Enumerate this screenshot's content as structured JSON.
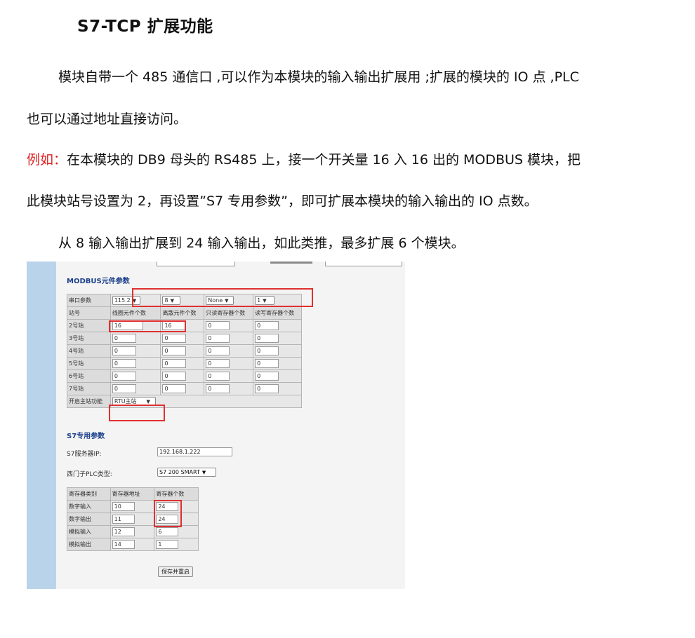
{
  "title": "S7-TCP 扩展功能",
  "paragraphs": {
    "p1_line1": "模块自带一个 485 通信口 ,可以作为本模块的输入输出扩展用 ;扩展的模块的 IO 点 ,PLC",
    "p1_line2": "也可以通过地址直接访问。",
    "example_label": "例如：",
    "p2_line1": "在本模块的 DB9 母头的 RS485 上，接一个开关量 16 入 16 出的 MODBUS 模块，把",
    "p2_line2": "此模块站号设置为 2，再设置”S7 专用参数”，即可扩展本模块的输入输出的 IO 点数。",
    "p3": "从 8 输入输出扩展到 24 输入输出，如此类推，最多扩展 6 个模块。"
  },
  "screenshot": {
    "modbus_title": "MODBUS元件参数",
    "serial_label": "串口参数",
    "serial_baud": "115.2",
    "serial_bits": "8",
    "serial_parity": "None",
    "serial_stop": "1",
    "headers": [
      "站号",
      "线圈元件个数",
      "离散元件个数",
      "只读寄存器个数",
      "读写寄存器个数"
    ],
    "stations": [
      {
        "name": "2号站",
        "v": [
          "16",
          "16",
          "0",
          "0"
        ]
      },
      {
        "name": "3号站",
        "v": [
          "0",
          "0",
          "0",
          "0"
        ]
      },
      {
        "name": "4号站",
        "v": [
          "0",
          "0",
          "0",
          "0"
        ]
      },
      {
        "name": "5号站",
        "v": [
          "0",
          "0",
          "0",
          "0"
        ]
      },
      {
        "name": "6号站",
        "v": [
          "0",
          "0",
          "0",
          "0"
        ]
      },
      {
        "name": "7号站",
        "v": [
          "0",
          "0",
          "0",
          "0"
        ]
      }
    ],
    "master_label": "开启主站功能",
    "master_value": "RTU主站",
    "s7_title": "S7专用参数",
    "server_ip_label": "S7服务器IP:",
    "server_ip_value": "192.168.1.222",
    "plc_type_label": "西门子PLC类型:",
    "plc_type_value": "S7 200 SMART",
    "reg_headers": [
      "寄存器类别",
      "寄存器地址",
      "寄存器个数"
    ],
    "reg_rows": [
      {
        "type": "数字输入",
        "addr": "10",
        "count": "24"
      },
      {
        "type": "数字输出",
        "addr": "11",
        "count": "24"
      },
      {
        "type": "模拟输入",
        "addr": "12",
        "count": "6"
      },
      {
        "type": "模拟输出",
        "addr": "14",
        "count": "1"
      }
    ],
    "save_button": "保存并重启",
    "highlight_color": "#e0302f"
  }
}
